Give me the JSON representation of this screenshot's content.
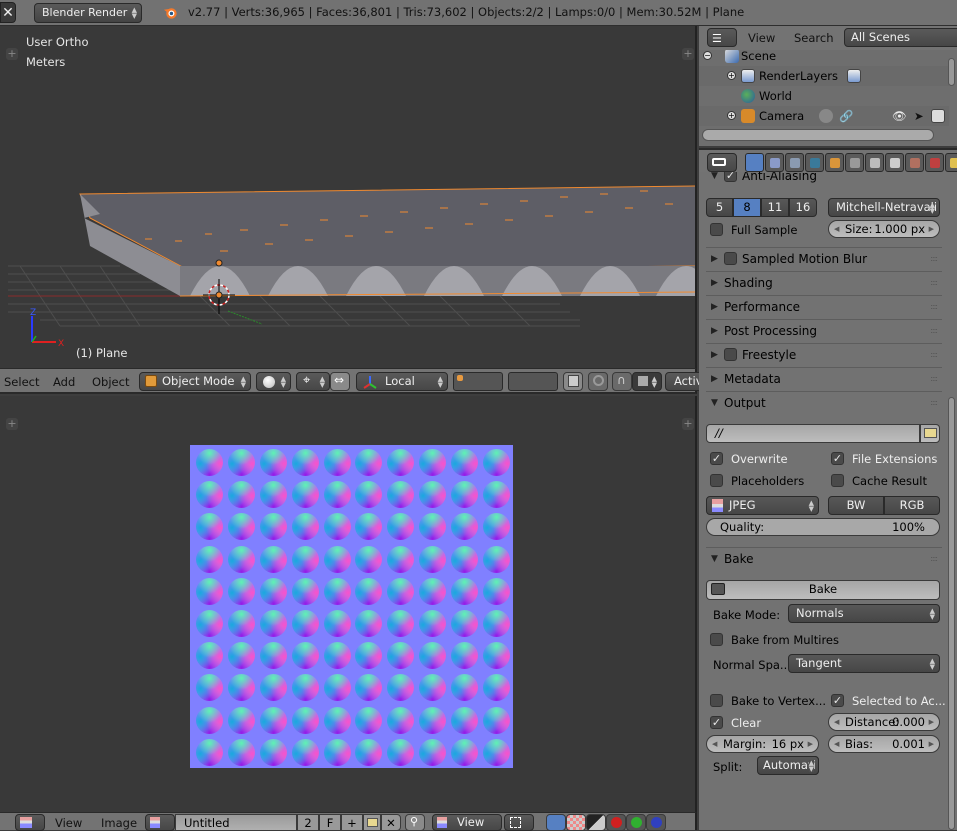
{
  "topbar": {
    "close_icon": "close-x-icon",
    "render_engine": "Blender Render",
    "stats": "v2.77 | Verts:36,965 | Faces:36,801 | Tris:73,602 | Objects:2/2 | Lamps:0/0 | Mem:30.52M | Plane"
  },
  "viewport": {
    "view_name": "User Ortho",
    "units": "Meters",
    "object_label": "(1) Plane",
    "axis_x": "X",
    "axis_z": "Z"
  },
  "viewport_header": {
    "menus": [
      "Select",
      "Add",
      "Object"
    ],
    "mode": "Object Mode",
    "orientation": "Local",
    "active_label": "Activ"
  },
  "image_editor": {
    "grid_rows": 10,
    "grid_cols": 10
  },
  "image_header": {
    "menus": [
      "View",
      "Image"
    ],
    "image_name": "Untitled",
    "users": "2",
    "fake_user": "F",
    "display_mode": "View"
  },
  "outliner": {
    "header": {
      "view": "View",
      "search": "Search",
      "scope": "All Scenes"
    },
    "items": [
      {
        "label": "Scene",
        "icon": "scene-icon"
      },
      {
        "label": "RenderLayers",
        "icon": "render-layers-icon"
      },
      {
        "label": "World",
        "icon": "world-icon"
      },
      {
        "label": "Camera",
        "icon": "camera-icon"
      }
    ]
  },
  "properties": {
    "tabs": [
      "render",
      "render-layers",
      "scene",
      "world",
      "object",
      "constraints",
      "modifiers",
      "data",
      "material",
      "texture",
      "particles"
    ],
    "anti_aliasing": {
      "title": "Anti-Aliasing",
      "samples": [
        "5",
        "8",
        "11",
        "16"
      ],
      "selected_sample": "8",
      "filter": "Mitchell-Netravali",
      "full_sample_label": "Full Sample",
      "size_label": "Size:",
      "size_value": "1.000 px"
    },
    "panels_collapsed": [
      {
        "label": "Sampled Motion Blur",
        "checkbox": true
      },
      {
        "label": "Shading",
        "checkbox": false
      },
      {
        "label": "Performance",
        "checkbox": false
      },
      {
        "label": "Post Processing",
        "checkbox": false
      },
      {
        "label": "Freestyle",
        "checkbox": true
      },
      {
        "label": "Metadata",
        "checkbox": false
      }
    ],
    "output": {
      "title": "Output",
      "path": "//",
      "overwrite": "Overwrite",
      "file_extensions": "File Extensions",
      "placeholders": "Placeholders",
      "cache_result": "Cache Result",
      "format": "JPEG",
      "bw": "BW",
      "rgb": "RGB",
      "quality_label": "Quality:",
      "quality_value": "100%"
    },
    "bake": {
      "title": "Bake",
      "bake_button": "Bake",
      "bake_mode_label": "Bake Mode:",
      "bake_mode": "Normals",
      "bake_from_multires": "Bake from Multires",
      "normal_space_label": "Normal Spa...",
      "normal_space": "Tangent",
      "bake_to_vertex": "Bake to Vertex...",
      "selected_to_active": "Selected to Ac...",
      "clear": "Clear",
      "distance_label": "Distance:",
      "distance_value": "0.000",
      "margin_label": "Margin:",
      "margin_value": "16 px",
      "bias_label": "Bias:",
      "bias_value": "0.001",
      "split_label": "Split:",
      "split_value": "Automati"
    }
  }
}
